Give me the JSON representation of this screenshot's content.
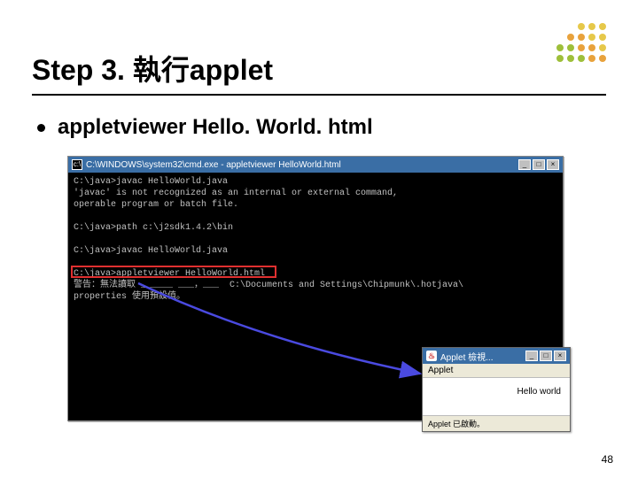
{
  "title": "Step 3. 執行applet",
  "bullet": "appletviewer Hello. World. html",
  "cmd": {
    "titlebar": "C:\\WINDOWS\\system32\\cmd.exe - appletviewer HelloWorld.html",
    "lines": "C:\\java>javac HelloWorld.java\n'javac' is not recognized as an internal or external command,\noperable program or batch file.\n\nC:\\java>path c:\\j2sdk1.4.2\\bin\n\nC:\\java>javac HelloWorld.java\n\nC:\\java>appletviewer HelloWorld.html\n警告：無法讀取 ______ ___，___  C:\\Documents and Settings\\Chipmunk\\.hotjava\\\nproperties 使用預設值。\n"
  },
  "applet": {
    "title": "Applet 檢視...",
    "menu": "Applet",
    "hello": "Hello world",
    "status": "Applet 已啟動。"
  },
  "buttons": {
    "min": "_",
    "max": "□",
    "close": "×"
  },
  "page": "48"
}
